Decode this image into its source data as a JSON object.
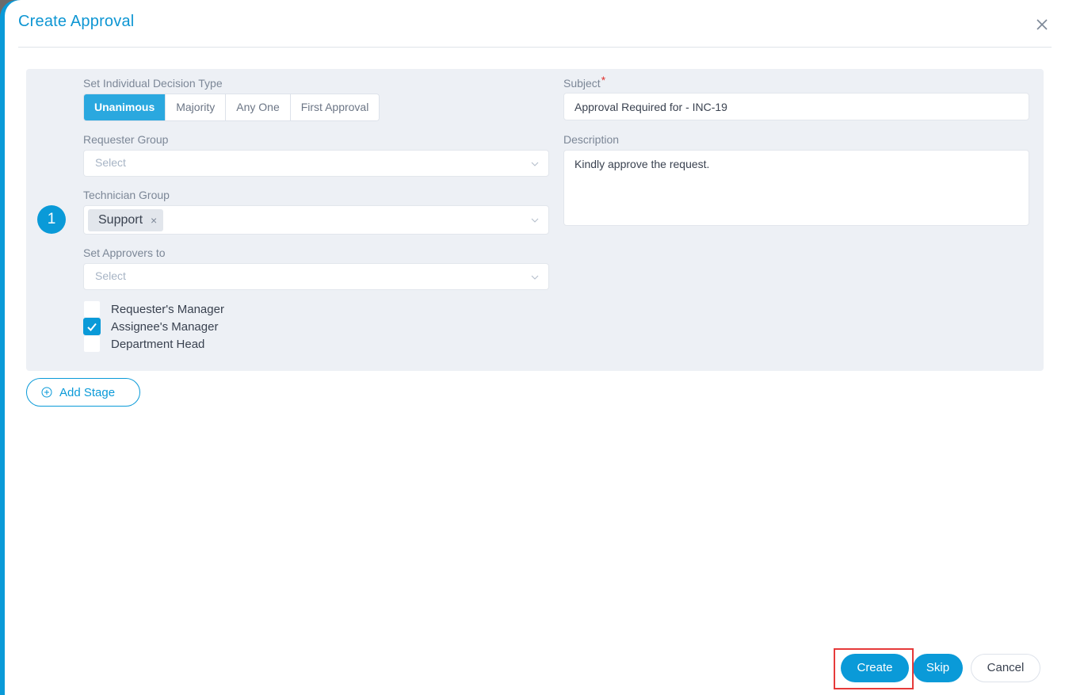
{
  "dialog": {
    "title": "Create Approval",
    "close_icon": "close-icon"
  },
  "stage": {
    "number": "1",
    "decision_type": {
      "label": "Set Individual Decision Type",
      "options": [
        "Unanimous",
        "Majority",
        "Any One",
        "First Approval"
      ],
      "selected": "Unanimous"
    },
    "requester_group": {
      "label": "Requester Group",
      "placeholder": "Select"
    },
    "technician_group": {
      "label": "Technician Group",
      "tags": [
        "Support"
      ],
      "remove_glyph": "×"
    },
    "set_approvers_to": {
      "label": "Set Approvers to",
      "placeholder": "Select"
    },
    "checkboxes": [
      {
        "label": "Requester's Manager",
        "checked": false
      },
      {
        "label": "Assignee's Manager",
        "checked": true
      },
      {
        "label": "Department Head",
        "checked": false
      }
    ],
    "subject": {
      "label": "Subject",
      "required_marker": "*",
      "value": "Approval Required for - INC-19"
    },
    "description": {
      "label": "Description",
      "value": "Kindly approve the request."
    }
  },
  "add_stage_label": "Add Stage",
  "footer": {
    "create_label": "Create",
    "skip_label": "Skip",
    "cancel_label": "Cancel"
  },
  "colors": {
    "accent": "#0a9ad8",
    "active_segment": "#2aa8df",
    "panel_bg": "#edf0f5",
    "required": "#e0322f",
    "highlight": "#e63a3a"
  }
}
